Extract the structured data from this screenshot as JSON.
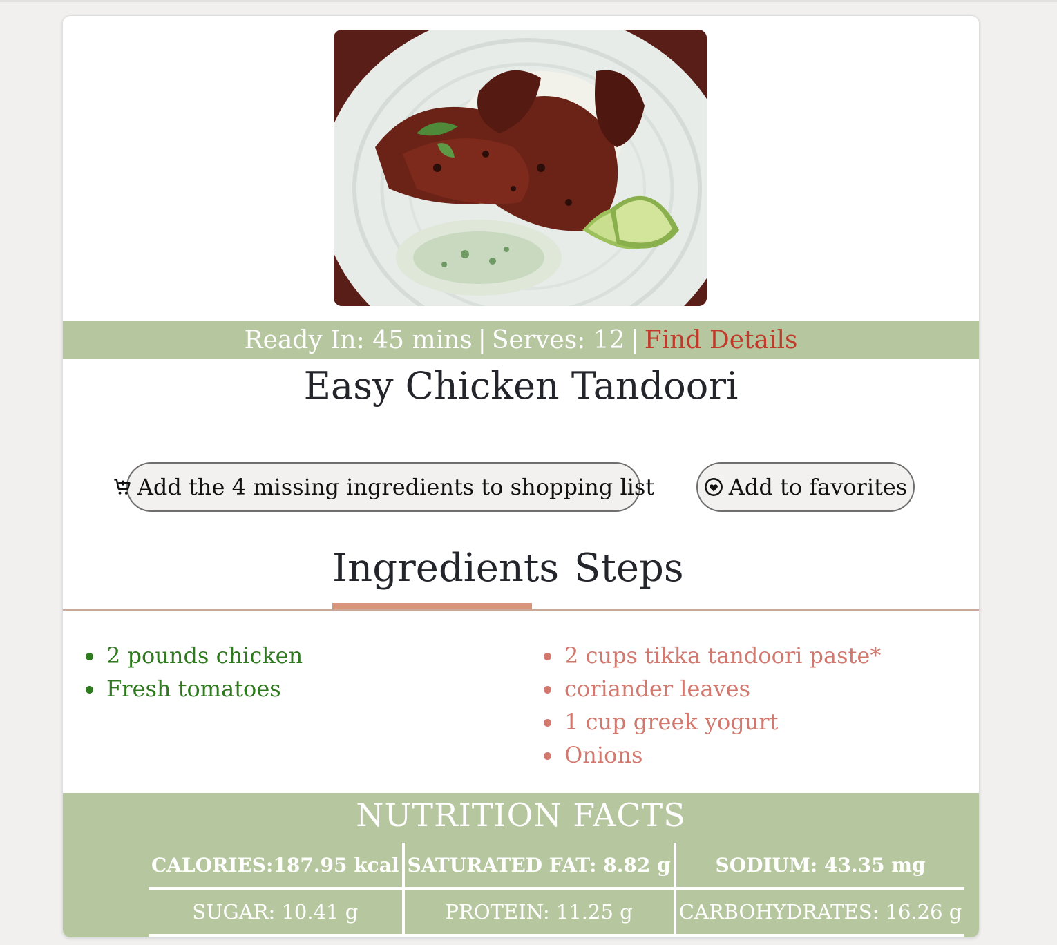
{
  "recipe": {
    "image_alt": "Easy Chicken Tandoori",
    "ready_label": "Ready In:",
    "ready_value": "45 mins",
    "serves_label": "Serves:",
    "serves_value": "12",
    "separator": "|",
    "find_details": "Find Details",
    "title": "Easy Chicken Tandoori"
  },
  "actions": {
    "shopping_label": "Add the 4 missing ingredients to shopping list",
    "shopping_icon": "cart-add-icon",
    "favorites_label": "Add to favorites",
    "favorites_icon": "heart-circle-icon"
  },
  "tabs": {
    "ingredients": "Ingredients",
    "steps": "Steps",
    "active": "Ingredients"
  },
  "ingredients": {
    "have": [
      "2 pounds chicken",
      "Fresh tomatoes"
    ],
    "missing": [
      "2 cups tikka tandoori paste*",
      "coriander leaves",
      "1 cup greek yogurt",
      "Onions"
    ]
  },
  "nutrition": {
    "title": "NUTRITION FACTS",
    "row1": [
      "CALORIES:187.95 kcal",
      "SATURATED FAT: 8.82 g",
      "SODIUM: 43.35 mg"
    ],
    "row2": [
      "SUGAR: 10.41 g",
      "PROTEIN: 11.25 g",
      "CARBOHYDRATES: 16.26 g"
    ]
  },
  "colors": {
    "accent_green": "#b6c79f",
    "have_text": "#2f7a1f",
    "missing_text": "#d2796f",
    "link_red": "#c03a2b",
    "tab_underline": "#d8957b"
  }
}
